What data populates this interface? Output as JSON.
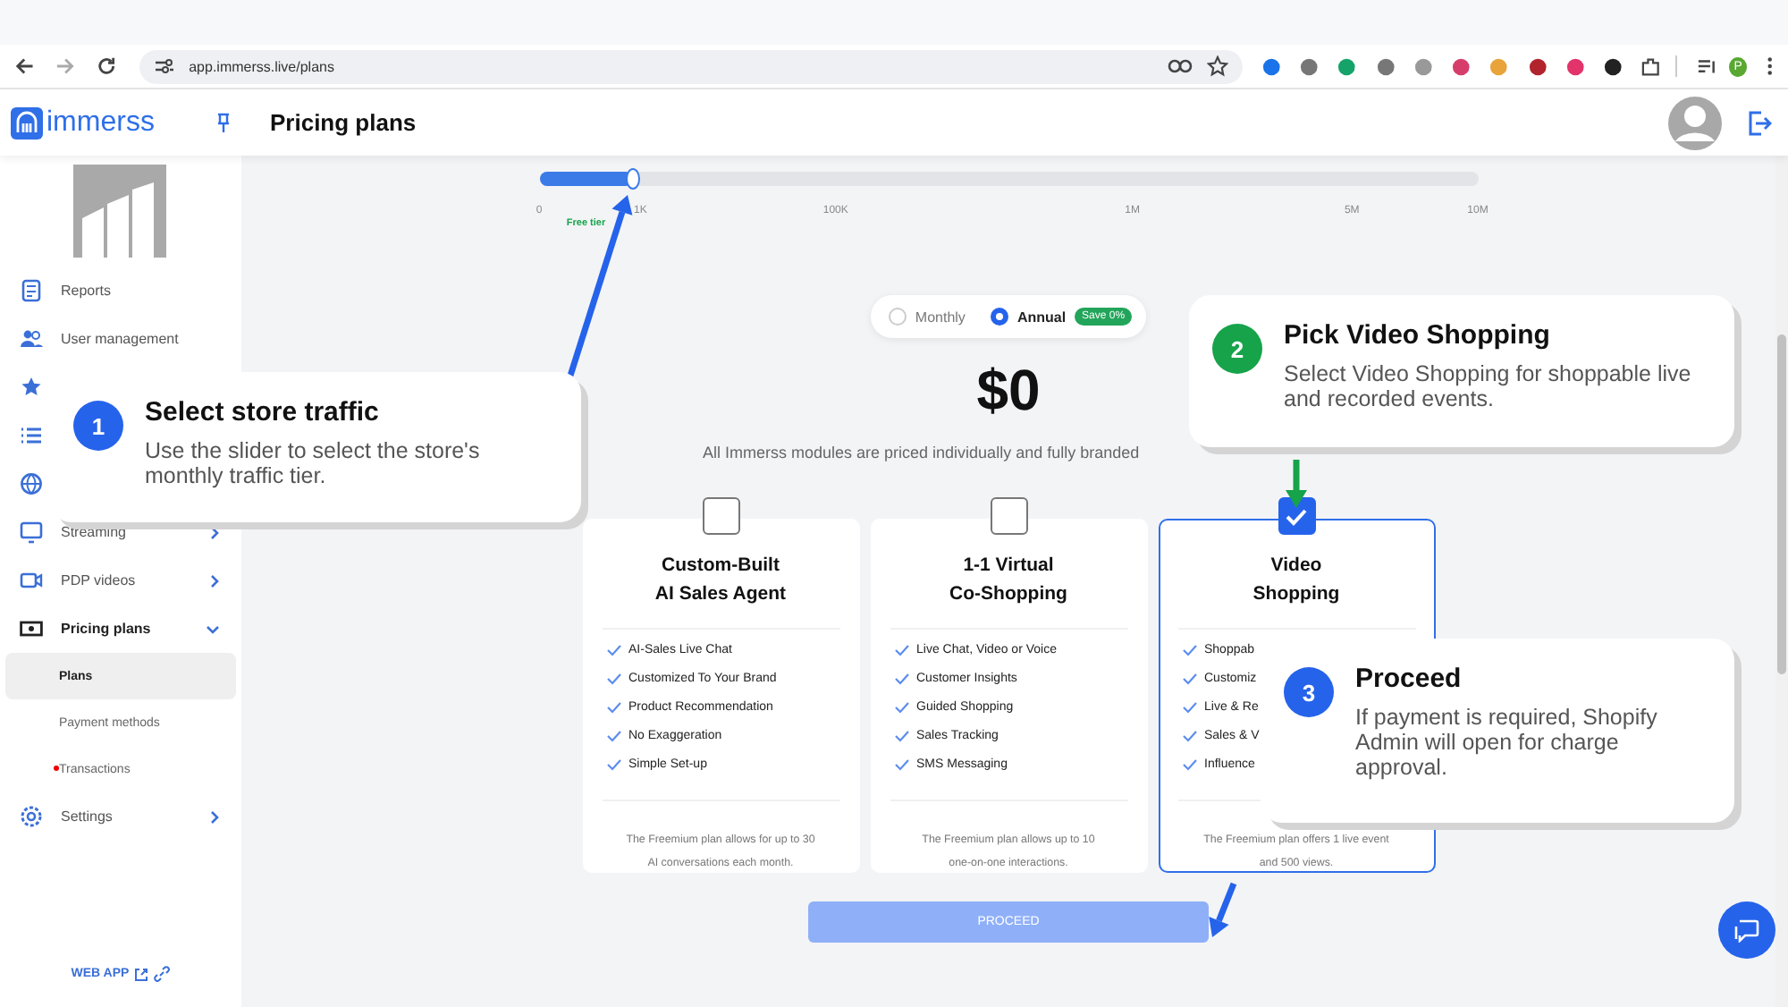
{
  "browser": {
    "url": "app.immerss.live/plans",
    "profile_initial": "P"
  },
  "header": {
    "logo": "immerss",
    "title": "Pricing plans"
  },
  "sidebar": {
    "items": [
      {
        "kind": "link",
        "label": "Reports"
      },
      {
        "kind": "link",
        "label": "User management"
      },
      {
        "kind": "icon_only"
      },
      {
        "kind": "icon_only"
      },
      {
        "kind": "icon_only"
      },
      {
        "kind": "link",
        "label": "Streaming",
        "expanded": false
      },
      {
        "kind": "link",
        "label": "PDP videos",
        "expanded": false
      },
      {
        "kind": "link",
        "label": "Pricing plans",
        "expanded": true,
        "children": [
          {
            "label": "Plans",
            "selected": true,
            "alert": false
          },
          {
            "label": "Payment methods",
            "selected": false,
            "alert": false
          },
          {
            "label": "Transactions",
            "selected": false,
            "alert": true
          }
        ]
      },
      {
        "kind": "link",
        "label": "Settings",
        "expanded": false
      }
    ],
    "web_app": "WEB APP"
  },
  "traffic_slider": {
    "level": 0.1,
    "ticks": [
      "0",
      "1K",
      "100K",
      "1M",
      "5M",
      "10M"
    ],
    "tier_label": "Free tier"
  },
  "billing_toggle": {
    "options": [
      {
        "label": "Monthly",
        "selected": false
      },
      {
        "label": "Annual",
        "selected": true,
        "badge": "Save 0%"
      }
    ]
  },
  "price": "$0",
  "description": "All Immerss modules are priced individually and fully branded",
  "plans": [
    {
      "title": "Custom-Built\nAI Sales Agent",
      "checked": false,
      "features": [
        "AI-Sales Live Chat",
        "Customized To Your Brand",
        "Product Recommendation",
        "No Exaggeration",
        "Simple Set-up"
      ],
      "note": "The Freemium plan allows for up to 30 AI conversations each month."
    },
    {
      "title": "1-1 Virtual\nCo-Shopping",
      "checked": false,
      "features": [
        "Live Chat, Video or Voice",
        "Customer Insights",
        "Guided Shopping",
        "Sales Tracking",
        "SMS Messaging"
      ],
      "note": "The Freemium plan allows up to 10 one-on-one interactions."
    },
    {
      "title": "Video\nShopping",
      "checked": true,
      "features": [
        "Shoppab",
        "Customiz",
        "Live & Re",
        "Sales & V",
        "Influence"
      ],
      "note": "The Freemium plan offers 1 live event and 500 views."
    }
  ],
  "proceed": {
    "label": "PROCEED",
    "disabled": true
  },
  "steps": [
    {
      "number": "1",
      "title": "Select store traffic",
      "body": "Use the slider to select the store's monthly traffic tier.",
      "color": "#2563eb"
    },
    {
      "number": "2",
      "title": "Pick Video Shopping",
      "body": "Select Video Shopping for shoppable live and recorded events.",
      "color": "#16a34a"
    },
    {
      "number": "3",
      "title": "Proceed",
      "body": "If payment is required, Shopify Admin will open for charge approval.",
      "color": "#2563eb"
    }
  ]
}
